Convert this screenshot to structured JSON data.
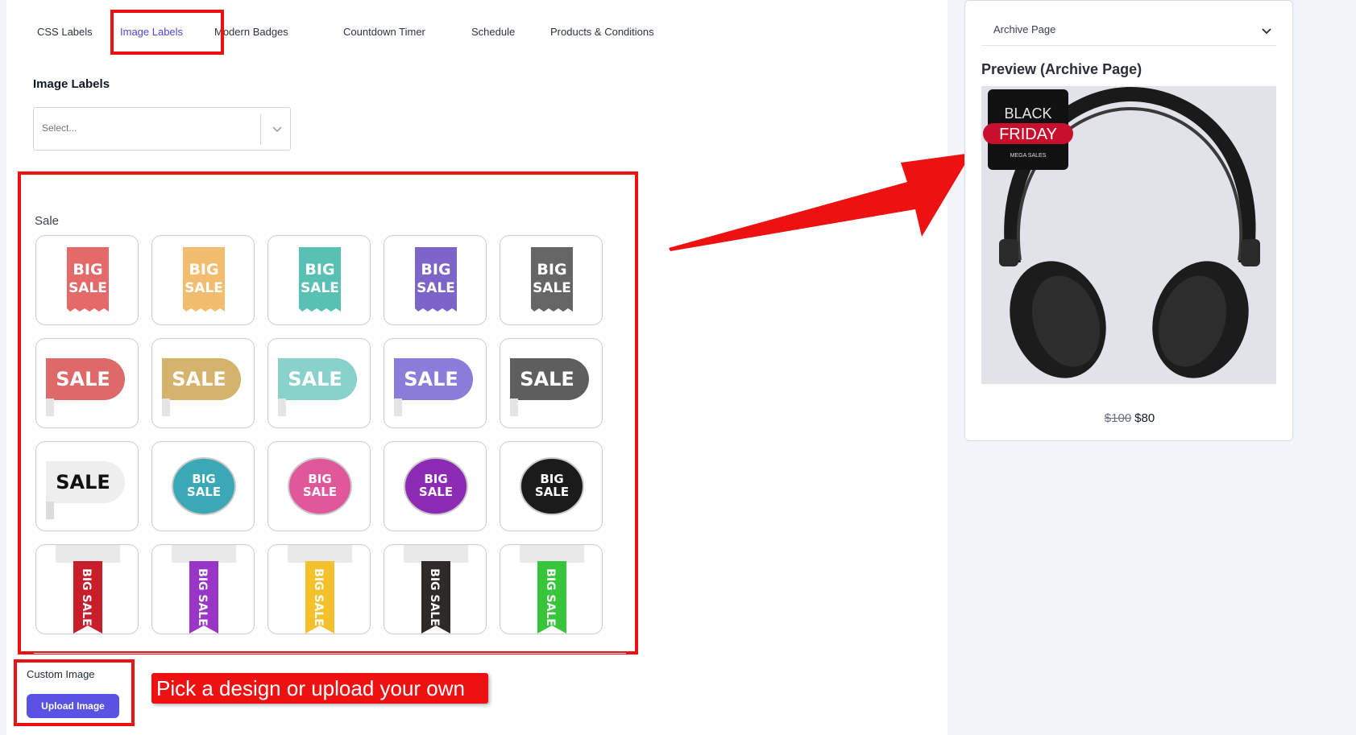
{
  "tabs": [
    {
      "label": "CSS Labels",
      "active": false
    },
    {
      "label": "Image Labels",
      "active": true
    },
    {
      "label": "Modern Badges",
      "active": false
    },
    {
      "label": "Countdown Timer",
      "active": false
    },
    {
      "label": "Schedule",
      "active": false
    },
    {
      "label": "Products & Conditions",
      "active": false
    }
  ],
  "image_labels": {
    "title": "Image Labels",
    "select_placeholder": "Select..."
  },
  "gallery": {
    "group_label": "Sale",
    "rows": [
      {
        "style": "ribbon-vertical",
        "text": [
          "BIG",
          "SALE"
        ],
        "colors": [
          "#e46a6a",
          "#f2bd6e",
          "#58c1b3",
          "#7c64c9",
          "#666666"
        ]
      },
      {
        "style": "tag-horizontal",
        "text": [
          "SALE"
        ],
        "colors": [
          "#de6969",
          "#d4b46c",
          "#89d1cb",
          "#8a7cd8",
          "#5e5e5e"
        ]
      },
      {
        "style": "mixed",
        "items": [
          {
            "shape": "tag",
            "text": [
              "SALE"
            ],
            "color": "#eeeeee"
          },
          {
            "shape": "circle",
            "text": [
              "BIG",
              "SALE"
            ],
            "color": "#3aa8b5"
          },
          {
            "shape": "circle",
            "text": [
              "BIG",
              "SALE"
            ],
            "color": "#e0579a"
          },
          {
            "shape": "circle",
            "text": [
              "BIG",
              "SALE"
            ],
            "color": "#8d2ab4"
          },
          {
            "shape": "circle",
            "text": [
              "BIG",
              "SALE"
            ],
            "color": "#1b1b1b"
          }
        ]
      },
      {
        "style": "bookmark-vertical",
        "text": [
          "BIG SALE"
        ],
        "colors": [
          "#c81e2a",
          "#9a36c7",
          "#f3c12c",
          "#2e2a27",
          "#36c53b"
        ]
      }
    ]
  },
  "custom_image": {
    "label": "Custom Image",
    "button_label": "Upload Image"
  },
  "callout_text": "Pick a design or upload your own",
  "preview": {
    "page_select": "Archive Page",
    "title": "Preview (Archive Page)",
    "badge": {
      "line1": "BLACK",
      "line2": "FRIDAY",
      "line3": "MEGA SALES"
    },
    "price_old": "$100",
    "price_new": "$80"
  },
  "colors": {
    "accent": "#5a52e3",
    "highlight": "#ee1111"
  }
}
